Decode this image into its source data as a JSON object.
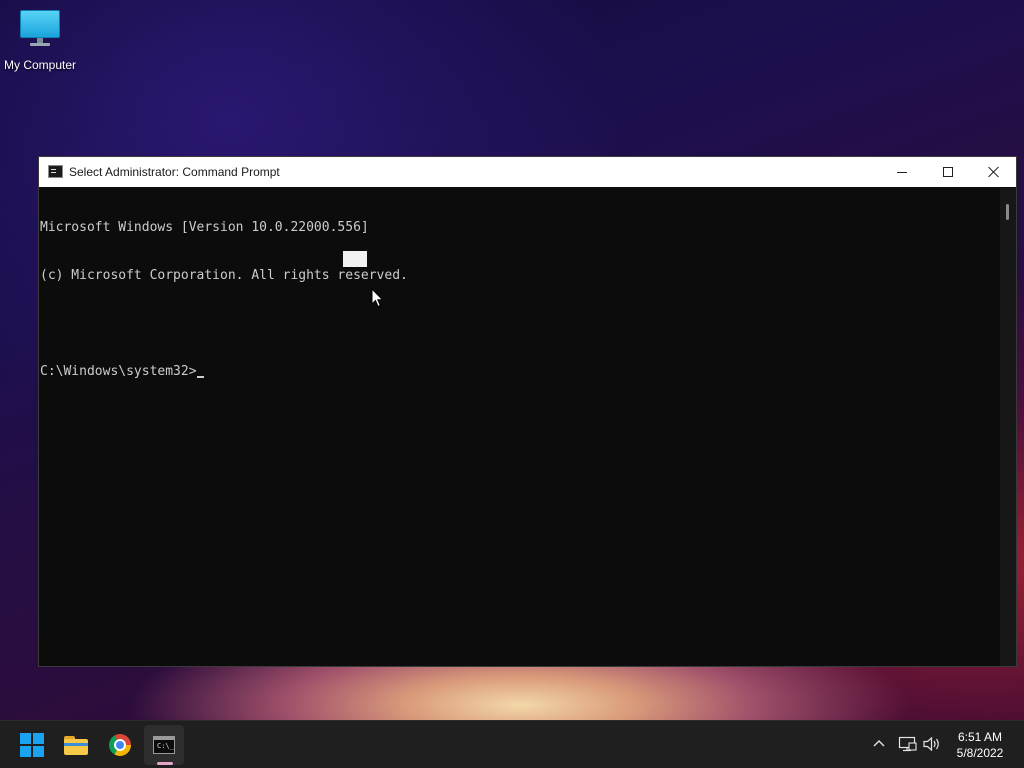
{
  "desktop": {
    "icons": [
      {
        "label": "My Computer",
        "icon": "monitor-icon"
      }
    ]
  },
  "window": {
    "title": "Select Administrator: Command Prompt",
    "icon": "cmd-icon",
    "controls": {
      "minimize": "minimize-icon",
      "maximize": "maximize-icon",
      "close": "close-icon"
    },
    "console_lines": [
      "Microsoft Windows [Version 10.0.22000.556]",
      "(c) Microsoft Corporation. All rights reserved.",
      "",
      "C:\\Windows\\system32>"
    ]
  },
  "taskbar": {
    "apps": [
      {
        "name": "Start",
        "icon": "windows-logo-icon"
      },
      {
        "name": "File Explorer",
        "icon": "folder-icon"
      },
      {
        "name": "Google Chrome",
        "icon": "chrome-icon"
      },
      {
        "name": "Command Prompt",
        "icon": "cmd-icon",
        "active": true
      }
    ],
    "tray": {
      "icons": [
        "chevron-up-icon",
        "network-icon",
        "volume-icon"
      ],
      "time": "6:51 AM",
      "date": "5/8/2022"
    }
  },
  "colors": {
    "console_bg": "#0c0c0c",
    "console_text": "#cccccc",
    "titlebar_bg": "#ffffff",
    "taskbar_bg": "#1f1f1f",
    "accent": "#1aa3f0"
  }
}
